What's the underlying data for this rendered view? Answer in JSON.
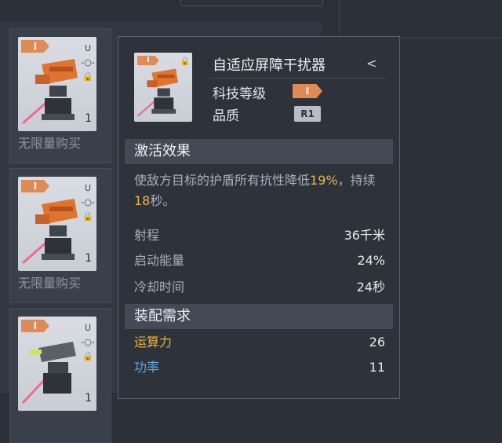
{
  "items": [
    {
      "tier": "I",
      "slot": "U",
      "quantity": "1",
      "label": "无限量购买"
    },
    {
      "tier": "I",
      "slot": "U",
      "quantity": "1",
      "label": "无限量购买"
    },
    {
      "tier": "I",
      "slot": "U",
      "quantity": "1",
      "label": ""
    }
  ],
  "tooltip": {
    "tier": "I",
    "title": "自适应屏障干扰器",
    "share_icon": "share-icon",
    "tech_level_label": "科技等级",
    "tech_level_value": "I",
    "quality_label": "品质",
    "quality_value": "R1",
    "activation_header": "激活效果",
    "desc_prefix": "使敌方目标的护盾所有抗性降低",
    "desc_value1": "19%",
    "desc_middle": "，持续",
    "desc_value2": "18",
    "desc_suffix": "秒。",
    "stats": [
      {
        "label": "射程",
        "value": "36千米"
      },
      {
        "label": "启动能量",
        "value": "24%"
      },
      {
        "label": "冷却时间",
        "value": "24秒"
      }
    ],
    "requirement_header": "装配需求",
    "requirements": [
      {
        "label": "运算力",
        "value": "26",
        "color": "#e9b33a"
      },
      {
        "label": "功率",
        "value": "11",
        "color": "#5fa8e6"
      }
    ]
  }
}
